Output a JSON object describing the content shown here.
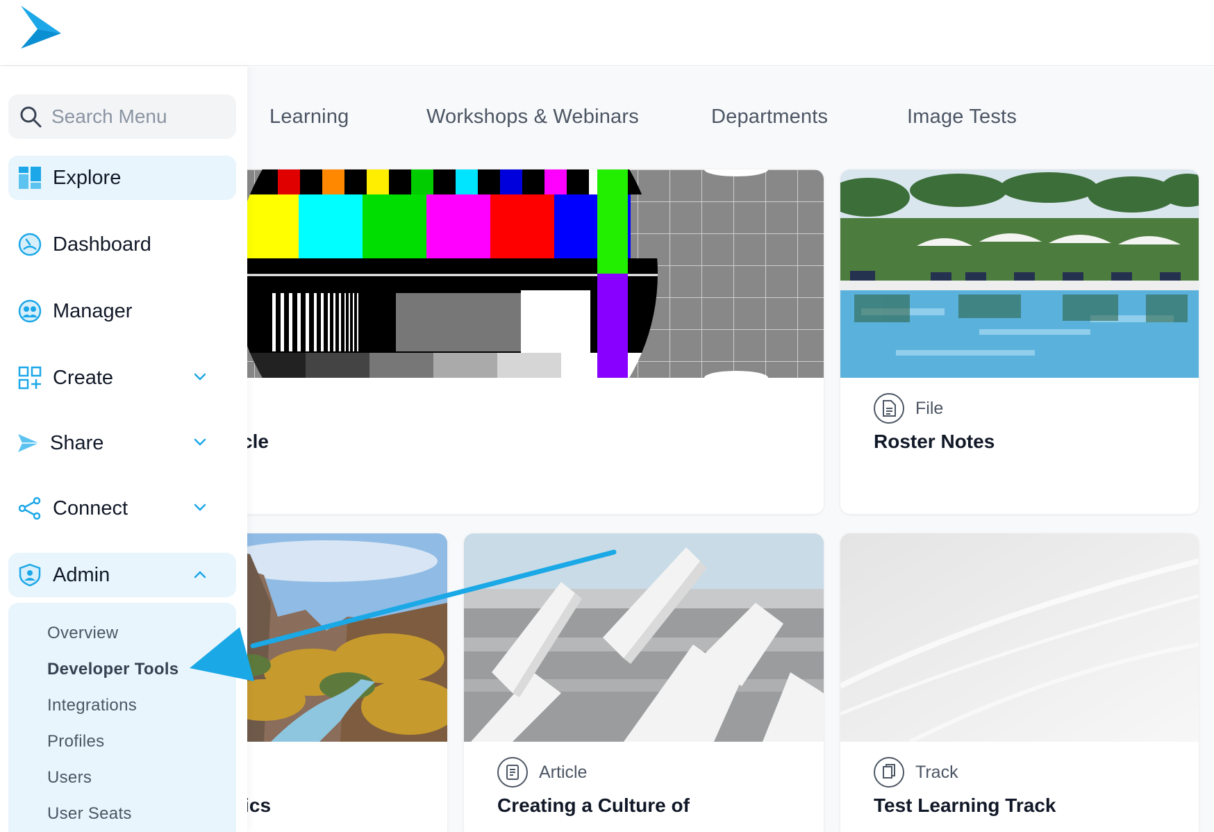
{
  "search": {
    "placeholder": "Search Menu"
  },
  "sidebar": {
    "items": [
      {
        "label": "Explore"
      },
      {
        "label": "Dashboard"
      },
      {
        "label": "Manager"
      },
      {
        "label": "Create"
      },
      {
        "label": "Share"
      },
      {
        "label": "Connect"
      },
      {
        "label": "Admin"
      }
    ],
    "admin_subitems": [
      {
        "label": "Overview"
      },
      {
        "label": "Developer Tools"
      },
      {
        "label": "Integrations"
      },
      {
        "label": "Profiles"
      },
      {
        "label": "Users"
      },
      {
        "label": "User Seats"
      }
    ]
  },
  "tabs": [
    {
      "label": "Learning"
    },
    {
      "label": "Workshops & Webinars"
    },
    {
      "label": "Departments"
    },
    {
      "label": "Image Tests"
    }
  ],
  "cards": [
    {
      "type": "",
      "title": "rticle",
      "icon": "article-icon"
    },
    {
      "type": "File",
      "title": "Roster Notes",
      "icon": "file-icon"
    },
    {
      "type": "",
      "title": "asics",
      "icon": ""
    },
    {
      "type": "Article",
      "title": "Creating a Culture of",
      "icon": "article-icon"
    },
    {
      "type": "Track",
      "title": "Test Learning Track",
      "icon": "track-icon"
    }
  ],
  "colors": {
    "brand": "#1ba7e8",
    "active_bg": "#e8f5fd",
    "annotation_arrow": "#1aa8e6"
  }
}
